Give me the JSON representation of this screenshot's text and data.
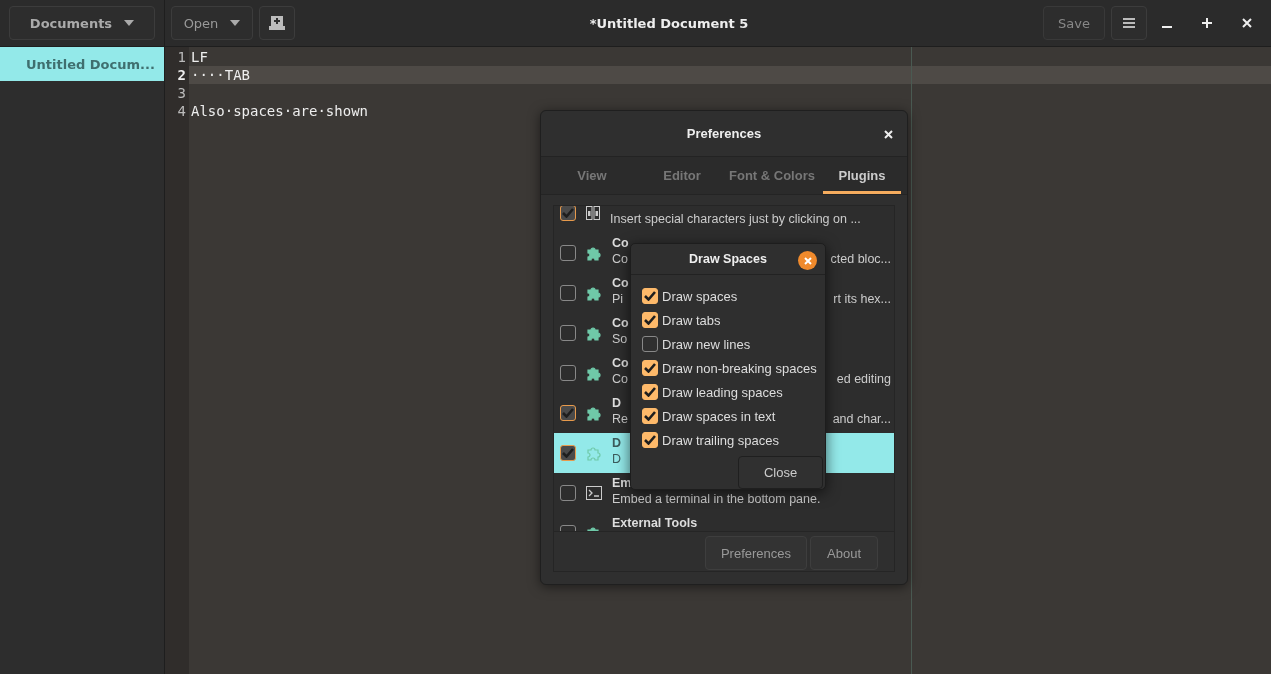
{
  "header": {
    "documents_button": "Documents",
    "open_button": "Open",
    "title": "*Untitled Document 5",
    "save_button": "Save"
  },
  "sidebar": {
    "documents": [
      {
        "title": "Untitled Docum...",
        "selected": true
      }
    ]
  },
  "editor": {
    "lines": [
      {
        "number": "1",
        "text": "LF",
        "current": false
      },
      {
        "number": "2",
        "text": "····TAB",
        "current": true
      },
      {
        "number": "3",
        "current": false
      },
      {
        "number": "4",
        "text": "Also·spaces·are·shown",
        "current": false
      }
    ]
  },
  "preferences": {
    "title": "Preferences",
    "tabs": [
      {
        "label": "View",
        "selected": false
      },
      {
        "label": "Editor",
        "selected": false
      },
      {
        "label": "Font & Colors",
        "selected": false
      },
      {
        "label": "Plugins",
        "selected": true
      }
    ],
    "plugins": [
      {
        "kind": "charmap",
        "description": "Insert special characters just by clicking on ...",
        "checked": true,
        "selected": false
      },
      {
        "kind": "puzzle",
        "name": "Co",
        "description": "Co",
        "description_end": "cted bloc...",
        "checked": false,
        "selected": false
      },
      {
        "kind": "puzzle",
        "name": "Co",
        "description": "Pi",
        "description_end": "rt its hex...",
        "checked": false,
        "selected": false
      },
      {
        "kind": "puzzle",
        "name": "Co",
        "description": "So",
        "checked": false,
        "selected": false
      },
      {
        "kind": "puzzle",
        "name": "Co",
        "description": "Co",
        "description_end": "ed editing",
        "checked": false,
        "selected": false
      },
      {
        "kind": "puzzle",
        "name": "D",
        "description": "Re",
        "description_end": "and char...",
        "checked": true,
        "selected": false
      },
      {
        "kind": "puzzle",
        "name": "D",
        "description": "D",
        "checked": true,
        "selected": true
      },
      {
        "kind": "terminal",
        "name": "Em",
        "description": "Embed a terminal in the bottom pane.",
        "checked": false,
        "selected": false
      },
      {
        "kind": "puzzle",
        "name": "External Tools",
        "checked": false,
        "selected": false
      }
    ],
    "buttons": [
      "Preferences",
      "About"
    ]
  },
  "draw_spaces": {
    "title": "Draw Spaces",
    "options": [
      {
        "label": "Draw spaces",
        "checked": true
      },
      {
        "label": "Draw tabs",
        "checked": true
      },
      {
        "label": "Draw new lines",
        "checked": false
      },
      {
        "label": "Draw non-breaking spaces",
        "checked": true
      },
      {
        "label": "Draw leading spaces",
        "checked": true
      },
      {
        "label": "Draw spaces in text",
        "checked": true
      },
      {
        "label": "Draw trailing spaces",
        "checked": true
      }
    ],
    "close_button": "Close"
  }
}
